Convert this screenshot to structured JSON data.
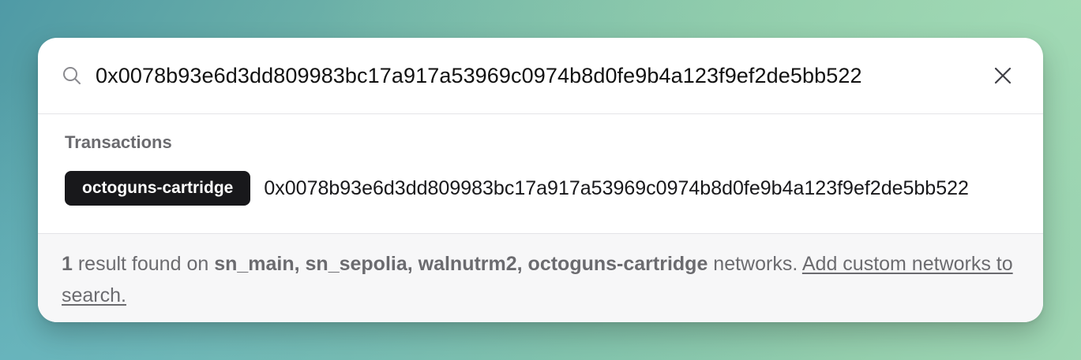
{
  "search": {
    "value": "0x0078b93e6d3dd809983bc17a917a53969c0974b8d0fe9b4a123f9ef2de5bb522",
    "search_icon": "search-icon",
    "clear_icon": "close-icon"
  },
  "results": {
    "section_label": "Transactions",
    "items": [
      {
        "network": "octoguns-cartridge",
        "hash": "0x0078b93e6d3dd809983bc17a917a53969c0974b8d0fe9b4a123f9ef2de5bb522"
      }
    ]
  },
  "footer": {
    "count": "1",
    "text_before": " result found on ",
    "networks": "sn_main, sn_sepolia, walnutrm2, octoguns-cartridge",
    "text_after": " networks. ",
    "link_text": "Add custom networks to search."
  },
  "colors": {
    "badge_bg": "#18181b",
    "muted_text": "#6b6b6f",
    "footer_bg": "#f7f7f8"
  }
}
